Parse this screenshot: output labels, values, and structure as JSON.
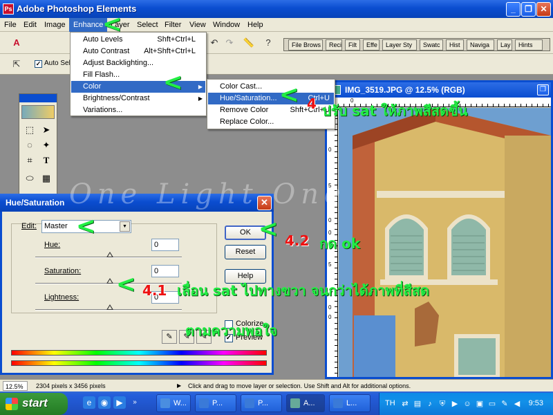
{
  "window": {
    "title": "Adobe Photoshop Elements"
  },
  "menubar": {
    "items": [
      "File",
      "Edit",
      "Image",
      "Enhance",
      "Layer",
      "Select",
      "Filter",
      "View",
      "Window",
      "Help"
    ]
  },
  "toolbar": {
    "auto_select_label": "Auto Sele"
  },
  "palette_tabs": [
    "File Brows",
    "Reci",
    "Filt",
    "Effe",
    "Layer Sty",
    "Swatc",
    "Hist",
    "Naviga",
    "Lay",
    "Hints"
  ],
  "enhance_menu": {
    "items": [
      {
        "label": "Auto Levels",
        "shortcut": "Shft+Ctrl+L"
      },
      {
        "label": "Auto Contrast",
        "shortcut": "Alt+Shft+Ctrl+L"
      },
      {
        "label": "Adjust Backlighting...",
        "shortcut": ""
      },
      {
        "label": "Fill Flash...",
        "shortcut": ""
      },
      {
        "label": "Color",
        "shortcut": ""
      },
      {
        "label": "Brightness/Contrast",
        "shortcut": ""
      },
      {
        "label": "Variations...",
        "shortcut": ""
      }
    ]
  },
  "color_submenu": {
    "items": [
      {
        "label": "Color Cast...",
        "shortcut": ""
      },
      {
        "label": "Hue/Saturation...",
        "shortcut": "Ctrl+U"
      },
      {
        "label": "Remove Color",
        "shortcut": "Shft+Ctrl+U"
      },
      {
        "label": "Replace Color...",
        "shortcut": ""
      }
    ]
  },
  "image_window": {
    "title": "IMG_3519.JPG @ 12.5% (RGB)",
    "ruler_top": "0",
    "ruler_left": [
      "5",
      "0",
      "5",
      "0",
      "0",
      "5",
      "0",
      "0"
    ]
  },
  "dialog": {
    "title": "Hue/Saturation",
    "edit_label": "Edit:",
    "edit_value": "Master",
    "hue_label": "Hue:",
    "hue_value": "0",
    "saturation_label": "Saturation:",
    "saturation_value": "0",
    "lightness_label": "Lightness:",
    "lightness_value": "0",
    "ok": "OK",
    "reset": "Reset",
    "help": "Help",
    "colorize": "Colorize",
    "preview": "Preview",
    "preview_checked": "✓"
  },
  "status": {
    "zoom": "12.5%",
    "size": "2304 pixels x 3456 pixels",
    "hint": "Click and drag to move layer or selection.  Use Shift and Alt for additional options."
  },
  "taskbar": {
    "start": "start",
    "tasks": [
      "W...",
      "P...",
      "P...",
      "A...",
      "L..."
    ],
    "lang": "TH",
    "clock": "9:53"
  },
  "annotations": {
    "step4_num": "4",
    "step4_text": "ปรับ sat ให้ภาพสีสดขึ้น",
    "step42_num": "4.2",
    "step42_text": "กด ok",
    "step41_num": "4.1",
    "step41_text": "เลื่อน sat ไปทางขวา จนกว่าได้ภาพที่สีสด",
    "step41_text2": "ตามความพอใจ",
    "watermark": "One Light One"
  },
  "colors": {
    "title_blue": "#0a4dd0",
    "menu_highlight": "#316ac5",
    "annotation_green": "#22ee44",
    "annotation_red": "#ee1111"
  }
}
